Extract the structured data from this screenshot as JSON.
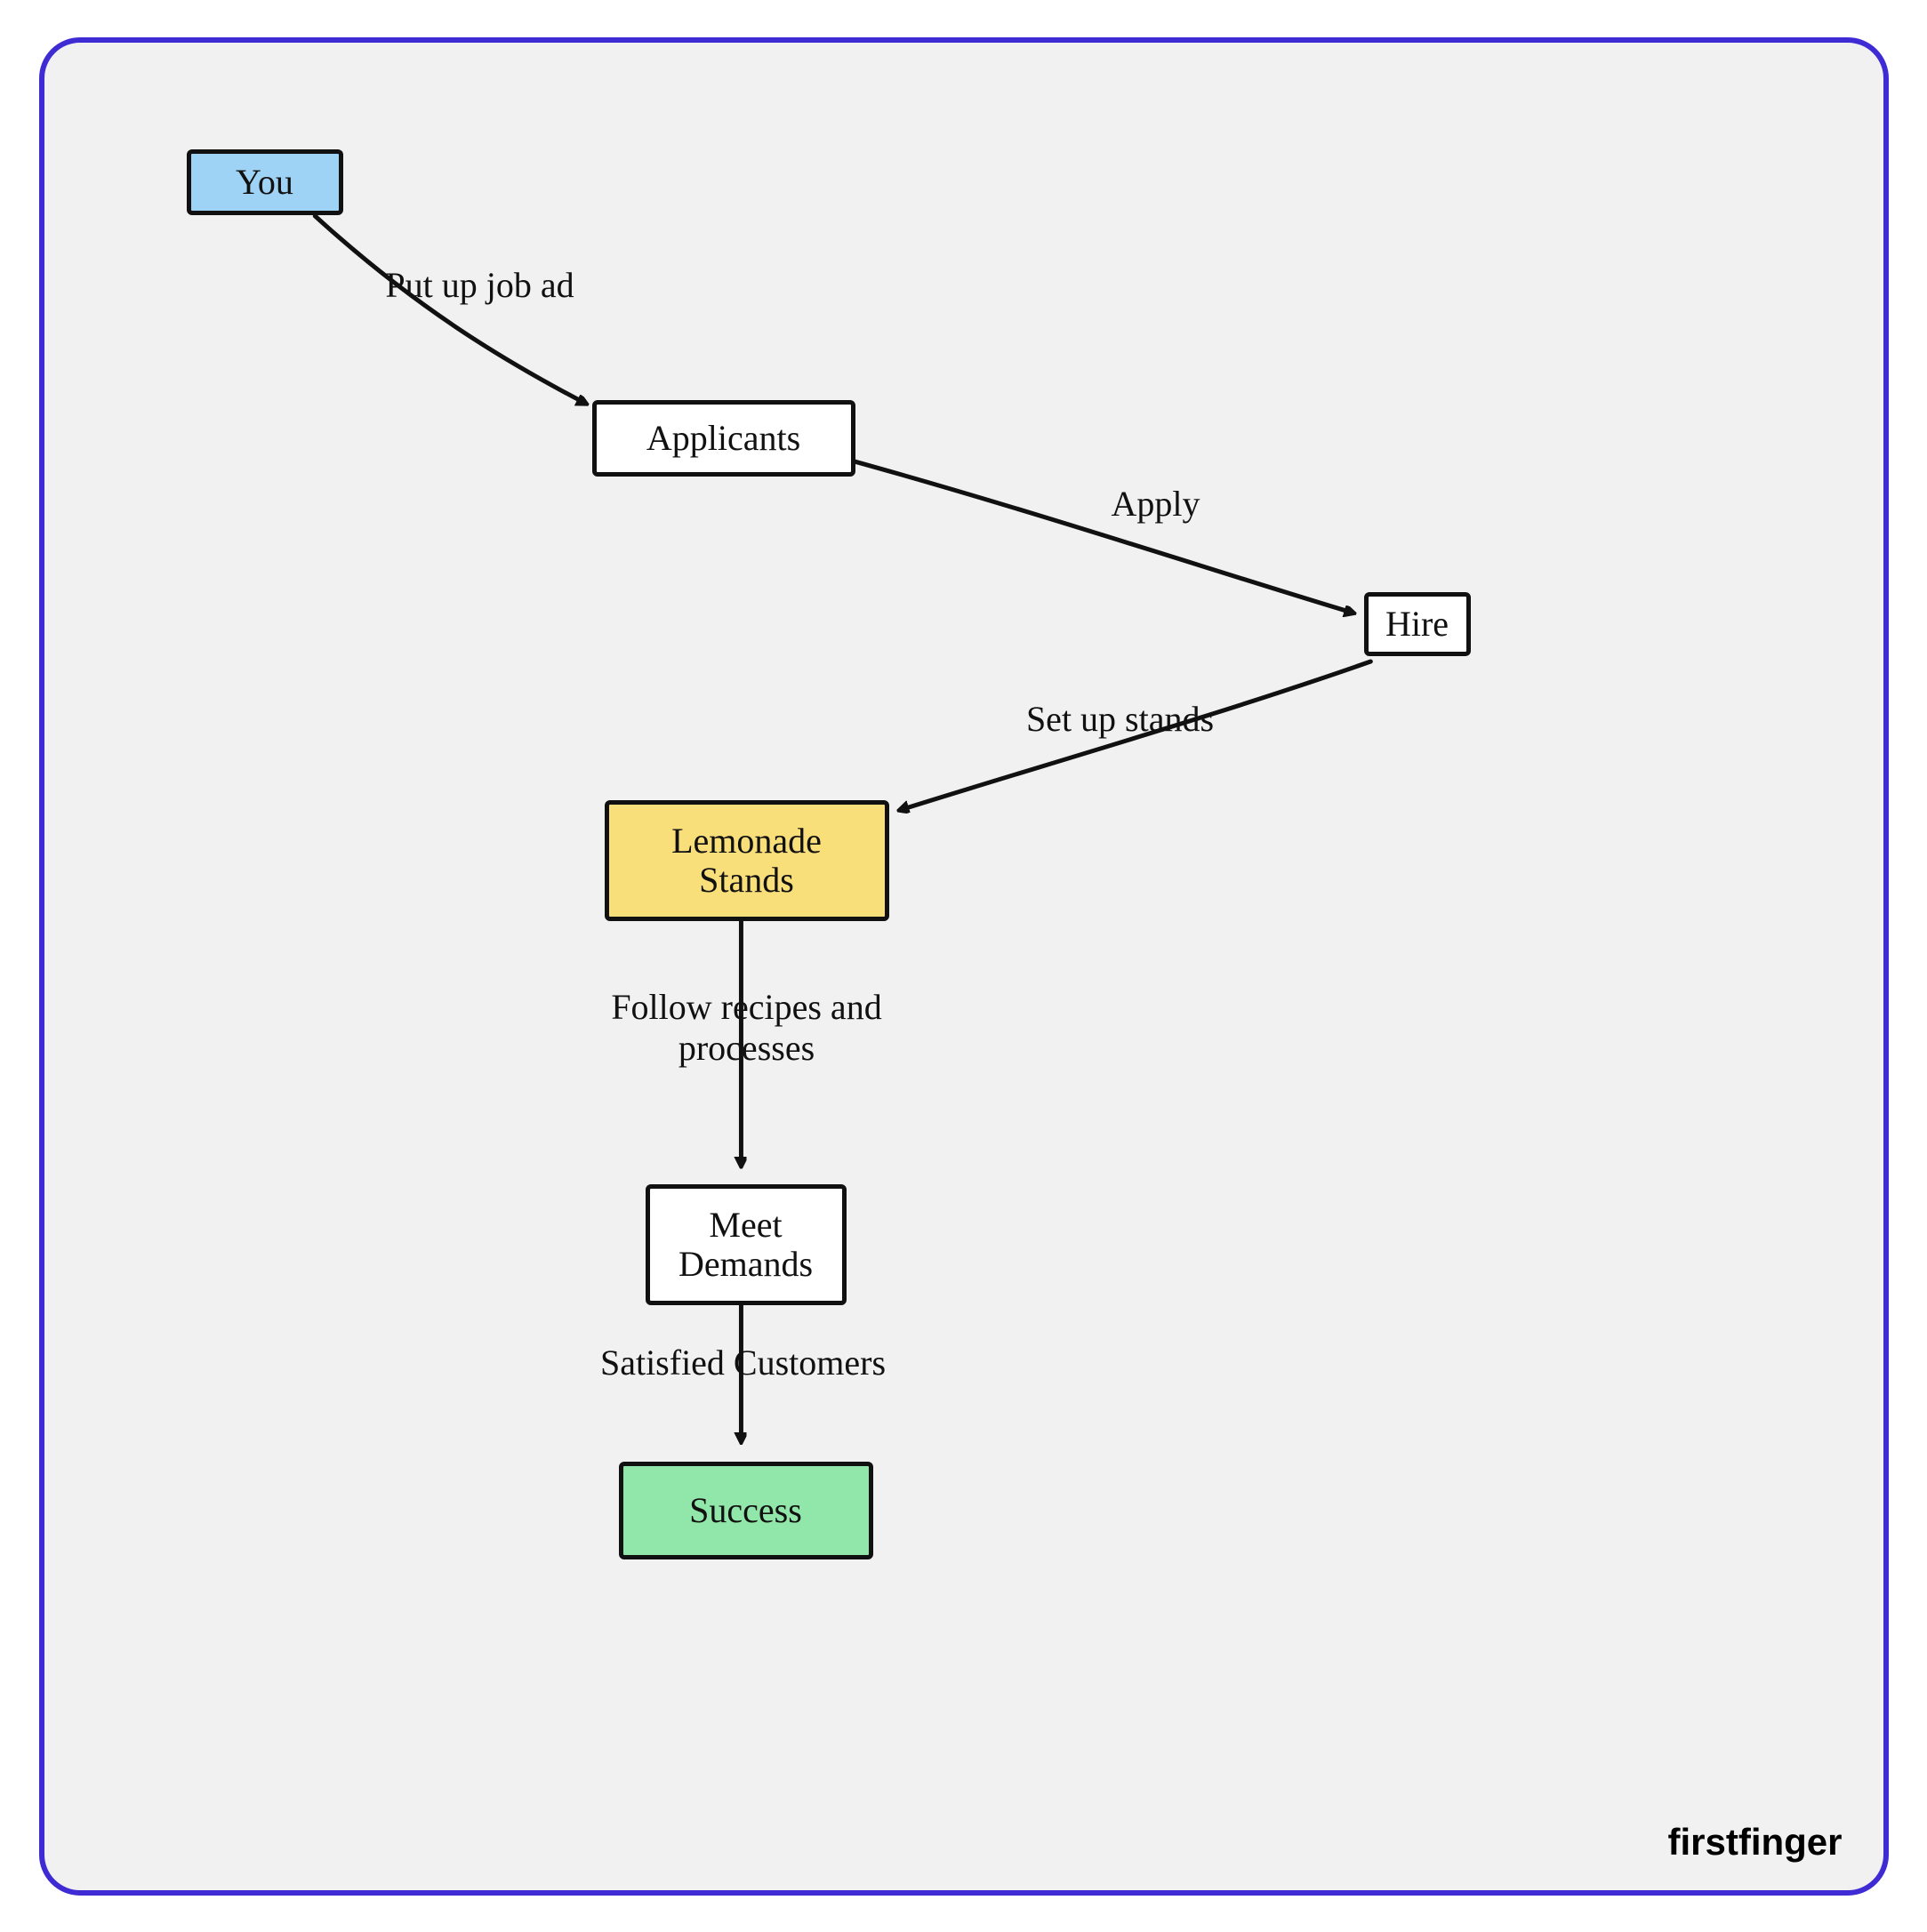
{
  "watermark": "firstfinger",
  "nodes": {
    "you": "You",
    "applicants": "Applicants",
    "hire": "Hire",
    "lemonade": "Lemonade\nStands",
    "meet": "Meet\nDemands",
    "success": "Success"
  },
  "edges": {
    "jobad": "Put up job ad",
    "apply": "Apply",
    "setup": "Set up stands",
    "follow": "Follow recipes and\nprocesses",
    "satisfied": "Satisfied Customers"
  },
  "colors": {
    "you": "#9ed3f5",
    "lemonade": "#f9df7a",
    "success": "#91e6a9"
  }
}
